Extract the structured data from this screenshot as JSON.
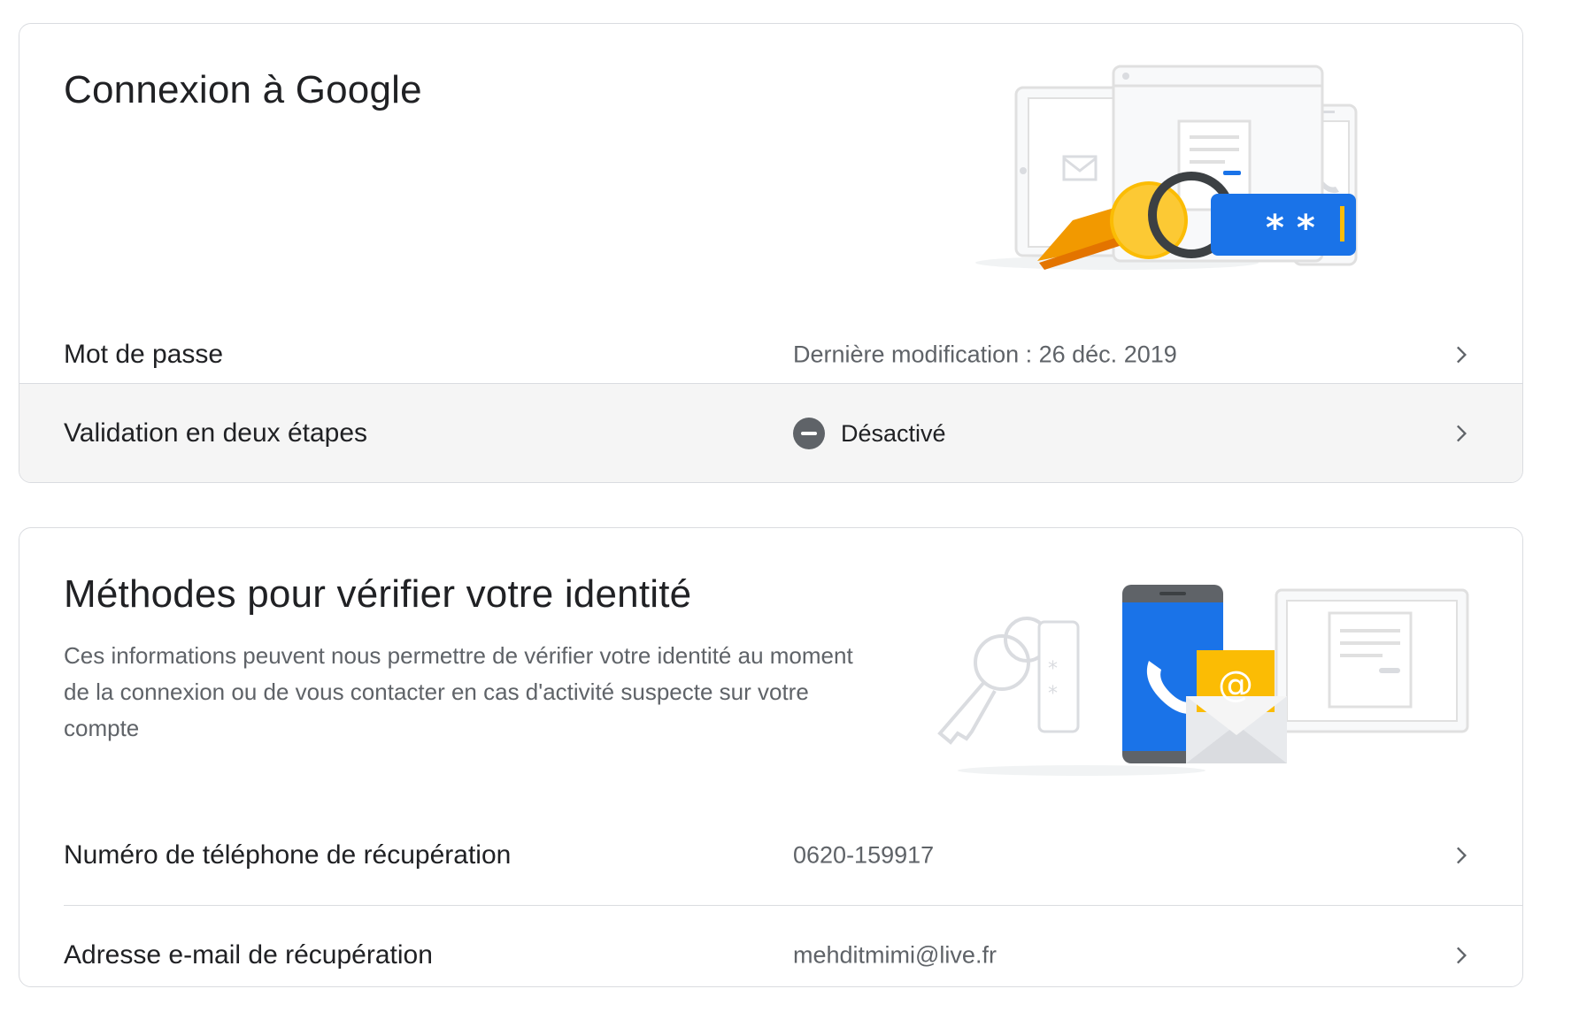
{
  "signin_card": {
    "title": "Connexion à Google",
    "rows": [
      {
        "label": "Mot de passe",
        "value": "Dernière modification : 26 déc. 2019"
      },
      {
        "label": "Validation en deux étapes",
        "value": "Désactivé",
        "status_icon": "minus-circle-icon"
      }
    ]
  },
  "identity_card": {
    "title": "Méthodes pour vérifier votre identité",
    "description": "Ces informations peuvent nous permettre de vérifier votre identité au moment de la connexion ou de vous contacter en cas d'activité sus­pecte sur votre compte",
    "rows": [
      {
        "label": "Numéro de téléphone de récupération",
        "value": "0620-159917"
      },
      {
        "label": "Adresse e-mail de récupération",
        "value": "mehditmimi@live.fr"
      }
    ]
  },
  "colors": {
    "accent_blue": "#1a73e8",
    "key_yellow": "#fbbc04",
    "key_orange": "#f29900",
    "text_primary": "#202124",
    "text_secondary": "#5f6368",
    "border": "#dadce0",
    "row_hover": "#f5f5f5"
  }
}
